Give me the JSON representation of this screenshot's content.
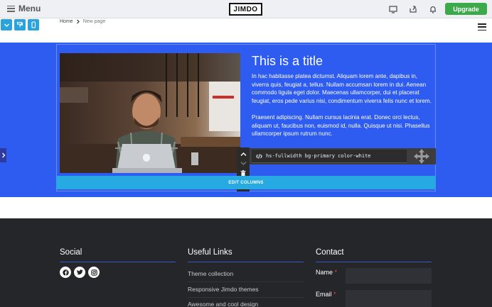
{
  "topbar": {
    "menu_label": "Menu",
    "logo_text": "JIMDO",
    "icons": [
      "monitor-icon",
      "share-icon",
      "bell-icon"
    ],
    "upgrade_label": "Upgrade"
  },
  "view_buttons": [
    "chevron-down-icon",
    "paint-roller-icon",
    "mobile-icon"
  ],
  "breadcrumb": {
    "home": "Home",
    "current": "New page"
  },
  "content": {
    "title": "This is a title",
    "paragraph1": "In hac habitasse platea dictumst. Aliquam lorem ante, dapibus in, viverra quis, feugiat a, tellus. Nullam accumsan lorem in dui. Aenean commodo ligula eget dolor. Maecenas ullamcorper, dui et placerat feugiat, eros pede varius nisi, condimentum viverra felis nunc et lorem.",
    "paragraph2": "Praesent adipiscing. Nullam cursus lacinia erat. Donec orci lectus, aliquam ut, faucibus non, euismod id, nulla. Quisque ut nisi. Phasellus ullamcorper ipsum rutrum nunc."
  },
  "module_toolbar": {
    "css_classes": "hs-fullwidth bg-primary color-white",
    "edit_columns_label": "EDIT COLUMNS"
  },
  "footer": {
    "social": {
      "title": "Social",
      "icons": [
        "facebook-icon",
        "twitter-icon",
        "instagram-icon"
      ]
    },
    "useful_links": {
      "title": "Useful Links",
      "items": [
        "Theme collection",
        "Responsive Jimdo themes",
        "Awesome and cool design"
      ]
    },
    "contact": {
      "title": "Contact",
      "name_label": "Name",
      "email_label": "Email",
      "required_mark": "*"
    }
  },
  "colors": {
    "primary_blue": "#2e5bf0",
    "accent_cyan": "#27aae1",
    "upgrade_green": "#3ca94a",
    "footer_bg": "#25262a"
  }
}
